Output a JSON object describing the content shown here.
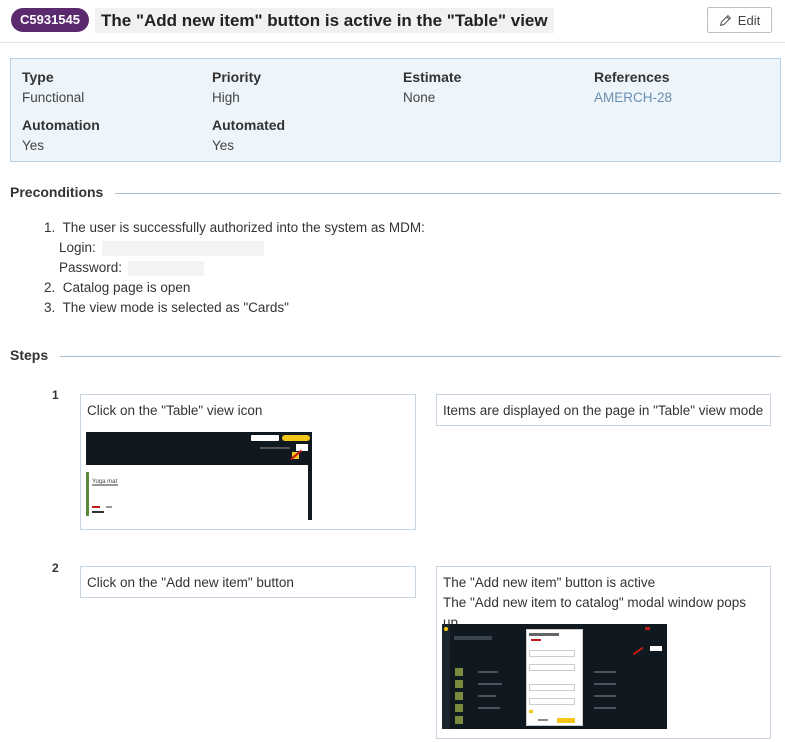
{
  "header": {
    "case_id": "C5931545",
    "title": "The \"Add new item\" button is active in the \"Table\" view",
    "edit_label": "Edit"
  },
  "properties": {
    "type": {
      "label": "Type",
      "value": "Functional"
    },
    "priority": {
      "label": "Priority",
      "value": "High"
    },
    "estimate": {
      "label": "Estimate",
      "value": "None"
    },
    "references": {
      "label": "References",
      "value": "AMERCH-28"
    },
    "automation": {
      "label": "Automation",
      "value": "Yes"
    },
    "automated": {
      "label": "Automated",
      "value": "Yes"
    }
  },
  "preconditions": {
    "title": "Preconditions",
    "items": [
      {
        "num": "1.",
        "text": "The user is successfully authorized into the system as MDM:"
      },
      {
        "num": "2.",
        "text": "Catalog page is open"
      },
      {
        "num": "3.",
        "text": "The view mode is selected as \"Cards\""
      }
    ],
    "login_label": "Login:",
    "password_label": "Password:"
  },
  "steps": {
    "title": "Steps",
    "items": [
      {
        "num": "1",
        "action": "Click on the \"Table\" view icon",
        "expected": [
          "Items are displayed on the page in \"Table\" view mode"
        ],
        "screenshot": {
          "card_title": "Yoga mat"
        }
      },
      {
        "num": "2",
        "action": "Click on the \"Add new item\" button",
        "expected": [
          "The \"Add new item\" button is active",
          "The \"Add new item to catalog\" modal window pops up"
        ]
      }
    ]
  },
  "colors": {
    "accent": "#5b2a6e",
    "props_bg": "#edf4fa",
    "link": "#6a8fb0",
    "app_dark": "#101820",
    "app_yellow": "#f5c518"
  }
}
